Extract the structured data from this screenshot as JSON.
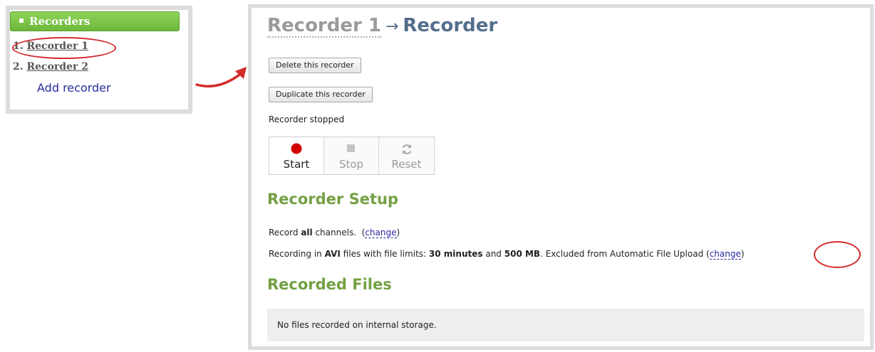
{
  "sidebar": {
    "header": "Recorders",
    "items": [
      {
        "num": "1.",
        "label": "Recorder 1"
      },
      {
        "num": "2.",
        "label": "Recorder 2"
      }
    ],
    "add_label": "Add recorder"
  },
  "main": {
    "breadcrumb": "Recorder 1",
    "separator": "→",
    "title": "Recorder",
    "delete_label": "Delete this recorder",
    "duplicate_label": "Duplicate this recorder",
    "status": "Recorder stopped",
    "controls": {
      "start": "Start",
      "stop": "Stop",
      "reset": "Reset"
    },
    "setup_heading": "Recorder Setup",
    "record_line": {
      "pre": "Record",
      "bold": "all",
      "post": "channels.",
      "change": "change"
    },
    "format_line": {
      "pre": "Recording in",
      "format": "AVI",
      "mid": "files with file limits:",
      "time_limit": "30 minutes",
      "and": "and",
      "size_limit": "500 MB",
      "post": ". Excluded from Automatic File Upload",
      "change": "change"
    },
    "files_heading": "Recorded Files",
    "files_empty": "No files recorded on internal storage."
  },
  "colors": {
    "accent_green": "#74a044",
    "title_blue": "#546e8c",
    "link_blue": "#2a2aa0",
    "annotation_red": "#d42a2a",
    "record_red": "#d40000"
  },
  "icons": {
    "header_bullet": "square-bullet-icon",
    "start": "record-dot-icon",
    "stop": "stop-square-icon",
    "reset": "refresh-icon",
    "annotation": "curved-arrow-icon"
  }
}
